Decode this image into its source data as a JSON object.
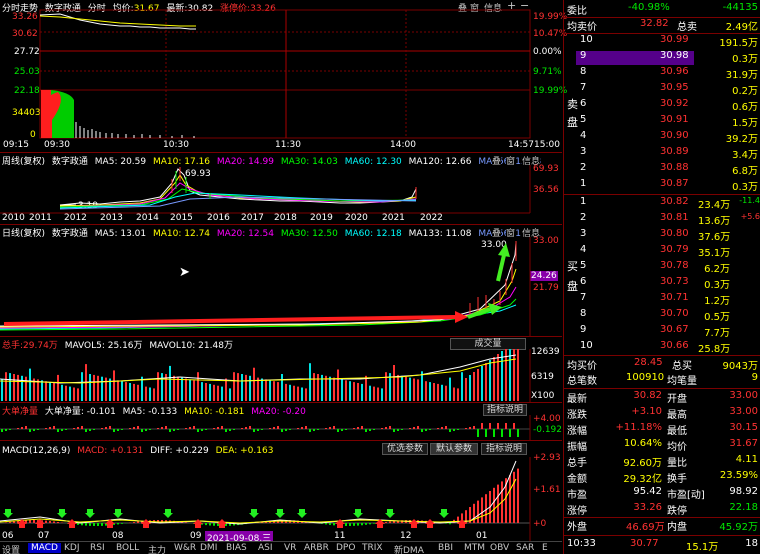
{
  "intraday": {
    "title": "分时走势",
    "stock": "数字政通",
    "mode": "分时",
    "avg_label": "均价:",
    "avg": "31.67",
    "latest_label": "最新:",
    "latest": "30.82",
    "limit_label": "涨停价:",
    "limit": "33.26",
    "left_axis": [
      "33.26",
      "30.62",
      "27.72",
      "25.03",
      "22.18",
      "34403",
      "0"
    ],
    "right_axis": [
      "19.99%",
      "10.47%",
      "0.00%",
      "9.71%",
      "19.99%"
    ],
    "time_axis": [
      "09:15",
      "09:30",
      "10:30",
      "11:30",
      "14:00",
      "14:57",
      "15:00"
    ],
    "buttons": [
      "叠",
      "窗",
      "信息"
    ]
  },
  "weekly": {
    "title": "周线(复权)",
    "stock": "数字政通",
    "ma": [
      {
        "label": "MA5: 20.59",
        "color": "#ffffff"
      },
      {
        "label": "MA10: 17.16",
        "color": "#ffff00"
      },
      {
        "label": "MA20: 14.99",
        "color": "#ff00ff"
      },
      {
        "label": "MA30: 14.03",
        "color": "#00ff00"
      },
      {
        "label": "MA60: 12.30",
        "color": "#00ffff"
      },
      {
        "label": "MA120: 12.66",
        "color": "#ffffff"
      },
      {
        "label": "MA256: 13.98",
        "color": "#7799ff"
      }
    ],
    "buttons": [
      "叠",
      "窗",
      "信息"
    ],
    "right_axis": [
      "69.93",
      "36.56"
    ],
    "peak_label": "69.93",
    "low_label": "3.19",
    "years": [
      "2010",
      "2011",
      "2012",
      "2013",
      "2014",
      "2015",
      "2016",
      "2017",
      "2018",
      "2019",
      "2020",
      "2021",
      "2022"
    ]
  },
  "daily": {
    "title": "日线(复权)",
    "stock": "数字政通",
    "ma": [
      {
        "label": "MA5: 13.01",
        "color": "#ffffff"
      },
      {
        "label": "MA10: 12.74",
        "color": "#ffff00"
      },
      {
        "label": "MA20: 12.54",
        "color": "#ff00ff"
      },
      {
        "label": "MA30: 12.50",
        "color": "#00ff00"
      },
      {
        "label": "MA60: 12.18",
        "color": "#00ffff"
      },
      {
        "label": "MA133: 11.08",
        "color": "#ffffff"
      },
      {
        "label": "MA256: 11.71",
        "color": "#7799ff"
      }
    ],
    "buttons": [
      "叠",
      "窗",
      "信息"
    ],
    "high_label": "33.00",
    "right_axis": [
      "33.00",
      "24.26",
      "21.79"
    ]
  },
  "volume": {
    "label": "总手:",
    "value": "29.74万",
    "mavol5": "MAVOL5: 25.16万",
    "mavol10": "MAVOL10: 21.48万",
    "dropdown": "成交量",
    "right_axis": [
      "12639",
      "6319",
      "X100"
    ]
  },
  "bignet": {
    "label": "大单净量",
    "value": "大单净量: -0.101",
    "ma5": "MA5: -0.133",
    "ma10": "MA10: -0.181",
    "ma20": "MA20: -0.20",
    "button": "指标说明",
    "right_axis": [
      "+4.00",
      "-0.192"
    ]
  },
  "macd": {
    "label": "MACD(12,26,9)",
    "macd": "MACD: +0.131",
    "diff": "DIFF: +0.229",
    "dea": "DEA: +0.163",
    "buttons": [
      "优选参数",
      "默认参数",
      "指标说明"
    ],
    "right_axis": [
      "+2.93",
      "+1.61",
      "+0"
    ],
    "months": [
      "06",
      "07",
      "08",
      "09",
      "10",
      "11",
      "12",
      "01"
    ],
    "date_badge": "2021-09-08,三"
  },
  "tabs": [
    "设置",
    "MACD",
    "KDJ",
    "RSI",
    "BOLL",
    "主力",
    "W&R",
    "DMI",
    "BIAS",
    "ASI",
    "VR",
    "ARBR",
    "DPO",
    "TRIX",
    "新DMA",
    "BBI",
    "MTM",
    "OBV",
    "SAR",
    "E"
  ],
  "quote": {
    "weibi_label": "委比",
    "weibi": "-40.98%",
    "weicha": "-44135",
    "junmai_label": "均卖价",
    "junmai": "32.82",
    "zongmai_label": "总卖",
    "zongmai": "2.49亿",
    "sell": [
      {
        "n": "10",
        "p": "30.99",
        "v": "191.5万"
      },
      {
        "n": "9",
        "p": "30.98",
        "v": "0.3万"
      },
      {
        "n": "8",
        "p": "30.96",
        "v": "31.9万"
      },
      {
        "n": "7",
        "p": "30.95",
        "v": "0.2万"
      },
      {
        "n": "6",
        "p": "30.92",
        "v": "0.6万"
      },
      {
        "n": "5",
        "p": "30.91",
        "v": "1.5万"
      },
      {
        "n": "4",
        "p": "30.90",
        "v": "39.2万"
      },
      {
        "n": "3",
        "p": "30.89",
        "v": "3.4万"
      },
      {
        "n": "2",
        "p": "30.88",
        "v": "6.8万"
      },
      {
        "n": "1",
        "p": "30.87",
        "v": "0.3万"
      }
    ],
    "sell_side_label": [
      "卖",
      "盘"
    ],
    "buy": [
      {
        "n": "1",
        "p": "30.82",
        "v": "23.4万",
        "d": "-11.4"
      },
      {
        "n": "2",
        "p": "30.81",
        "v": "13.6万",
        "d": "+5.6"
      },
      {
        "n": "3",
        "p": "30.80",
        "v": "37.6万",
        "d": ""
      },
      {
        "n": "4",
        "p": "30.79",
        "v": "35.1万",
        "d": ""
      },
      {
        "n": "5",
        "p": "30.78",
        "v": "6.2万",
        "d": ""
      },
      {
        "n": "6",
        "p": "30.73",
        "v": "0.3万",
        "d": ""
      },
      {
        "n": "7",
        "p": "30.71",
        "v": "1.2万",
        "d": ""
      },
      {
        "n": "8",
        "p": "30.70",
        "v": "0.5万",
        "d": ""
      },
      {
        "n": "9",
        "p": "30.67",
        "v": "7.7万",
        "d": ""
      },
      {
        "n": "10",
        "p": "30.66",
        "v": "25.8万",
        "d": ""
      }
    ],
    "buy_side_label": [
      "买",
      "盘"
    ],
    "junmai2_label": "均买价",
    "junmai2": "28.45",
    "zongmai2_label": "总买",
    "zongmai2": "9043万",
    "bishu_label": "总笔数",
    "bishu": "100910",
    "junbi_label": "均笔量",
    "junbi": "9",
    "stats": [
      {
        "l1": "最新",
        "v1": "30.82",
        "c1": "#ff3232",
        "l2": "开盘",
        "v2": "33.00",
        "c2": "#ff3232"
      },
      {
        "l1": "涨跌",
        "v1": "+3.10",
        "c1": "#ff3232",
        "l2": "最高",
        "v2": "33.00",
        "c2": "#ff3232"
      },
      {
        "l1": "涨幅",
        "v1": "+11.18%",
        "c1": "#ff3232",
        "l2": "最低",
        "v2": "30.15",
        "c2": "#ff3232"
      },
      {
        "l1": "振幅",
        "v1": "10.64%",
        "c1": "#ffff00",
        "l2": "均价",
        "v2": "31.67",
        "c2": "#ff3232"
      },
      {
        "l1": "总手",
        "v1": "92.60万",
        "c1": "#ffff00",
        "l2": "量比",
        "v2": "4.11",
        "c2": "#ffff00"
      },
      {
        "l1": "金额",
        "v1": "29.32亿",
        "c1": "#ffff00",
        "l2": "换手",
        "v2": "23.59%",
        "c2": "#ffff00"
      },
      {
        "l1": "市盈",
        "v1": "95.42",
        "c1": "#ffffff",
        "l2": "市盈[动]",
        "v2": "98.92",
        "c2": "#ffffff"
      },
      {
        "l1": "涨停",
        "v1": "33.26",
        "c1": "#ff3232",
        "l2": "跌停",
        "v2": "22.18",
        "c2": "#00e600"
      }
    ],
    "waipan_label": "外盘",
    "waipan": "46.69万",
    "neipan_label": "内盘",
    "neipan": "45.92万",
    "tick": {
      "time": "10:33",
      "price": "30.77",
      "vol": "15.1万",
      "n": "18"
    }
  },
  "colors": {
    "up": "#ff3232",
    "down": "#00e600",
    "frame": "#7a0000",
    "arrow_red": "#ff1e1e",
    "arrow_green": "#44ee22"
  }
}
